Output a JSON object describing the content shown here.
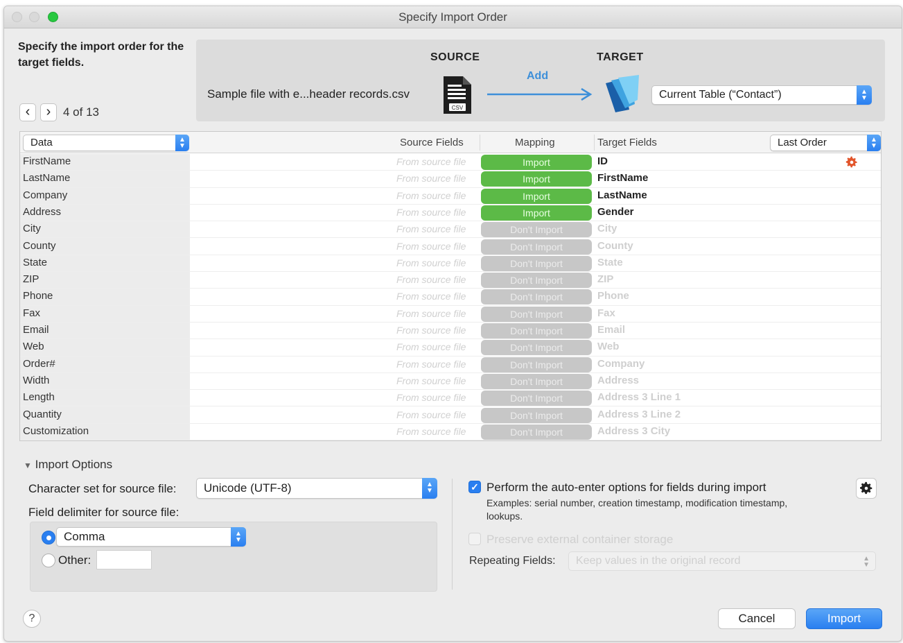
{
  "window": {
    "title": "Specify Import Order"
  },
  "header": {
    "instructions": "Specify the import order for the target fields.",
    "counter": "4 of 13"
  },
  "source": {
    "heading": "SOURCE",
    "filename": "Sample file with e...header records.csv",
    "file_badge": "CSV"
  },
  "target": {
    "heading": "TARGET",
    "action_label": "Add",
    "table_select": "Current Table (“Contact”)"
  },
  "grid": {
    "data_select": "Data",
    "col_source": "Source Fields",
    "col_mapping": "Mapping",
    "col_target": "Target Fields",
    "order_select": "Last Order",
    "source_placeholder": "From source file",
    "rows": [
      {
        "data": "FirstName",
        "mapping": "Import",
        "active": true,
        "target": "ID"
      },
      {
        "data": "LastName",
        "mapping": "Import",
        "active": true,
        "target": "FirstName"
      },
      {
        "data": "Company",
        "mapping": "Import",
        "active": true,
        "target": "LastName"
      },
      {
        "data": "Address",
        "mapping": "Import",
        "active": true,
        "target": "Gender"
      },
      {
        "data": "City",
        "mapping": "Don't Import",
        "active": false,
        "target": "City"
      },
      {
        "data": "County",
        "mapping": "Don't Import",
        "active": false,
        "target": "County"
      },
      {
        "data": "State",
        "mapping": "Don't Import",
        "active": false,
        "target": "State"
      },
      {
        "data": "ZIP",
        "mapping": "Don't Import",
        "active": false,
        "target": "ZIP"
      },
      {
        "data": "Phone",
        "mapping": "Don't Import",
        "active": false,
        "target": "Phone"
      },
      {
        "data": "Fax",
        "mapping": "Don't Import",
        "active": false,
        "target": "Fax"
      },
      {
        "data": "Email",
        "mapping": "Don't Import",
        "active": false,
        "target": "Email"
      },
      {
        "data": "Web",
        "mapping": "Don't Import",
        "active": false,
        "target": "Web"
      },
      {
        "data": "Order#",
        "mapping": "Don't Import",
        "active": false,
        "target": "Company"
      },
      {
        "data": "Width",
        "mapping": "Don't Import",
        "active": false,
        "target": "Address"
      },
      {
        "data": "Length",
        "mapping": "Don't Import",
        "active": false,
        "target": "Address 3 Line 1"
      },
      {
        "data": "Quantity",
        "mapping": "Don't Import",
        "active": false,
        "target": "Address 3 Line 2"
      },
      {
        "data": "Customization",
        "mapping": "Don't Import",
        "active": false,
        "target": "Address 3 City"
      }
    ]
  },
  "options": {
    "toggle_label": "Import Options",
    "charset_label": "Character set for source file:",
    "charset_value": "Unicode (UTF-8)",
    "delimiter_label": "Field delimiter for source file:",
    "delimiter_value": "Comma",
    "other_label": "Other:",
    "auto_enter_label": "Perform the auto-enter options for fields during import",
    "auto_enter_checked": true,
    "auto_enter_examples": "Examples: serial number, creation timestamp, modification timestamp, lookups.",
    "preserve_label": "Preserve external container storage",
    "repeating_label": "Repeating Fields:",
    "repeating_value": "Keep values in the original record"
  },
  "footer": {
    "help": "?",
    "cancel": "Cancel",
    "import": "Import"
  },
  "colors": {
    "accent": "#2a7ff0",
    "import_green": "#5cba47",
    "dont_import_gray": "#c7c7c7",
    "warning_gear": "#e2552b"
  }
}
